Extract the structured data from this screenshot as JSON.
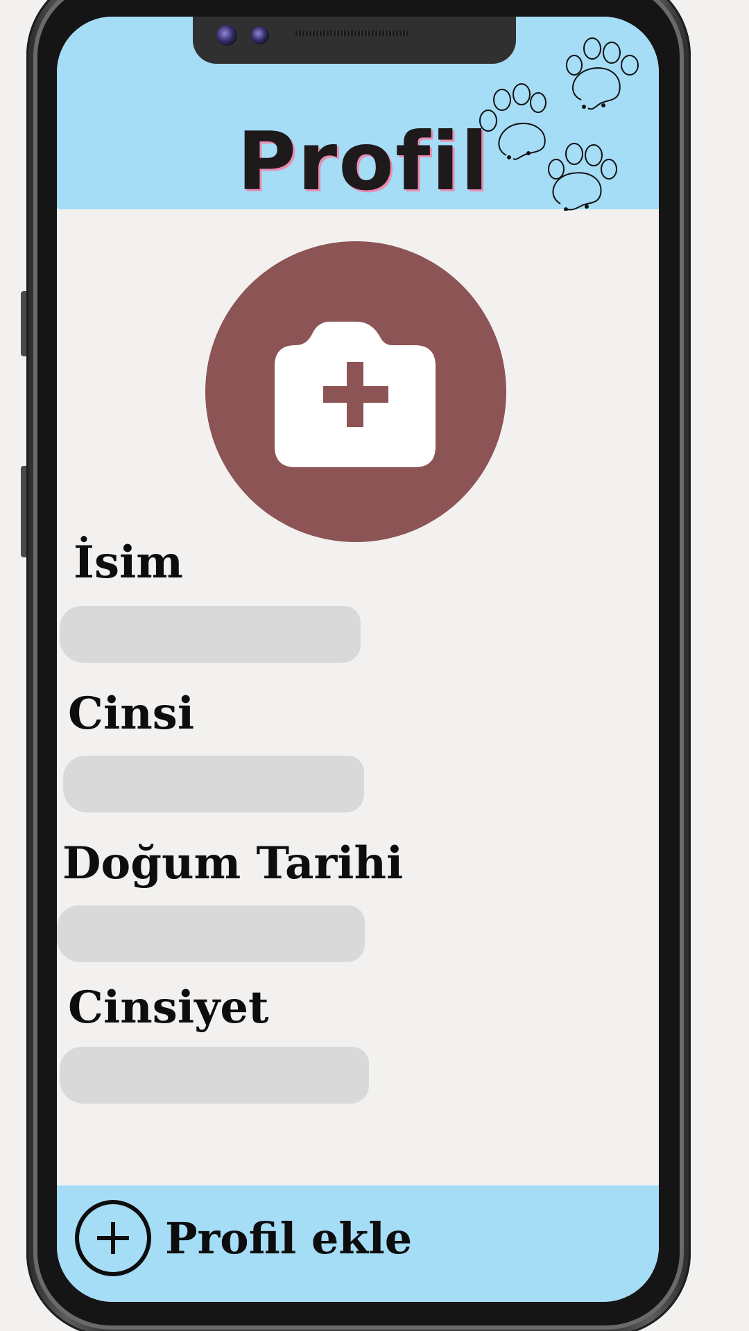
{
  "header": {
    "title": "Profil",
    "background_color": "#a5dcf6",
    "decoration": "paw-prints-icon"
  },
  "avatar": {
    "icon": "add-photo-camera-icon",
    "background_color": "#8c5455"
  },
  "form": {
    "fields": [
      {
        "label": "İsim",
        "value": ""
      },
      {
        "label": "Cinsi",
        "value": ""
      },
      {
        "label": "Doğum Tarihi",
        "value": ""
      },
      {
        "label": "Cinsiyet",
        "value": ""
      }
    ]
  },
  "footer": {
    "add_profile_label": "Profil ekle",
    "icon": "plus-circle-icon",
    "background_color": "#a5dcf6"
  }
}
